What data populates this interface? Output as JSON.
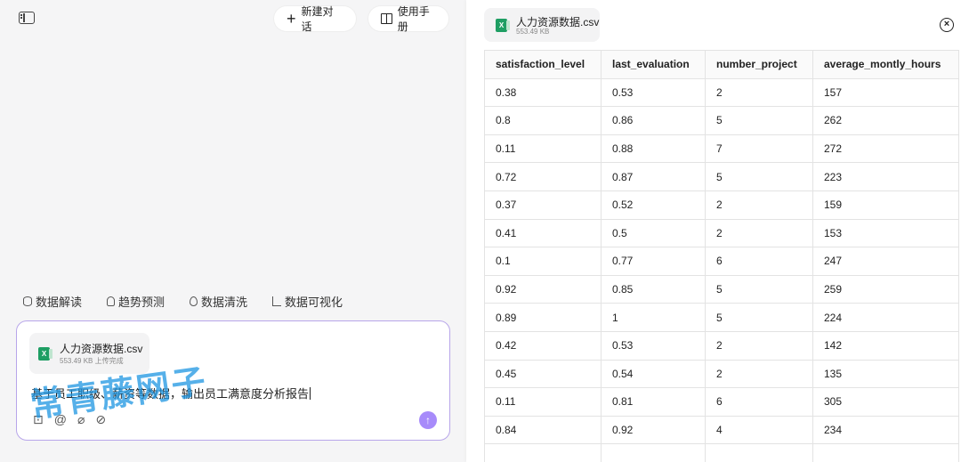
{
  "header": {
    "new_chat_label": "新建对话",
    "manual_label": "使用手册"
  },
  "quick_actions": [
    {
      "label": "数据解读",
      "icon": "database-icon"
    },
    {
      "label": "趋势预测",
      "icon": "bulb-icon"
    },
    {
      "label": "数据清洗",
      "icon": "drop-icon"
    },
    {
      "label": "数据可视化",
      "icon": "chart-icon"
    }
  ],
  "composer": {
    "file_name": "人力资源数据.csv",
    "file_meta": "553.49 KB 上传完成",
    "prompt_text": "基于员工职级、薪资等数据，输出员工满意度分析报告",
    "tools": [
      "⊡",
      "@",
      "⌀",
      "⊘"
    ]
  },
  "watermark": "常青藤网子",
  "preview": {
    "file_name": "人力资源数据.csv",
    "file_meta": "553.49 KB",
    "columns": [
      "satisfaction_level",
      "last_evaluation",
      "number_project",
      "average_montly_hours"
    ],
    "rows": [
      [
        "0.38",
        "0.53",
        "2",
        "157"
      ],
      [
        "0.8",
        "0.86",
        "5",
        "262"
      ],
      [
        "0.11",
        "0.88",
        "7",
        "272"
      ],
      [
        "0.72",
        "0.87",
        "5",
        "223"
      ],
      [
        "0.37",
        "0.52",
        "2",
        "159"
      ],
      [
        "0.41",
        "0.5",
        "2",
        "153"
      ],
      [
        "0.1",
        "0.77",
        "6",
        "247"
      ],
      [
        "0.92",
        "0.85",
        "5",
        "259"
      ],
      [
        "0.89",
        "1",
        "5",
        "224"
      ],
      [
        "0.42",
        "0.53",
        "2",
        "142"
      ],
      [
        "0.45",
        "0.54",
        "2",
        "135"
      ],
      [
        "0.11",
        "0.81",
        "6",
        "305"
      ],
      [
        "0.84",
        "0.92",
        "4",
        "234"
      ],
      [
        "",
        "",
        "",
        ""
      ]
    ]
  }
}
